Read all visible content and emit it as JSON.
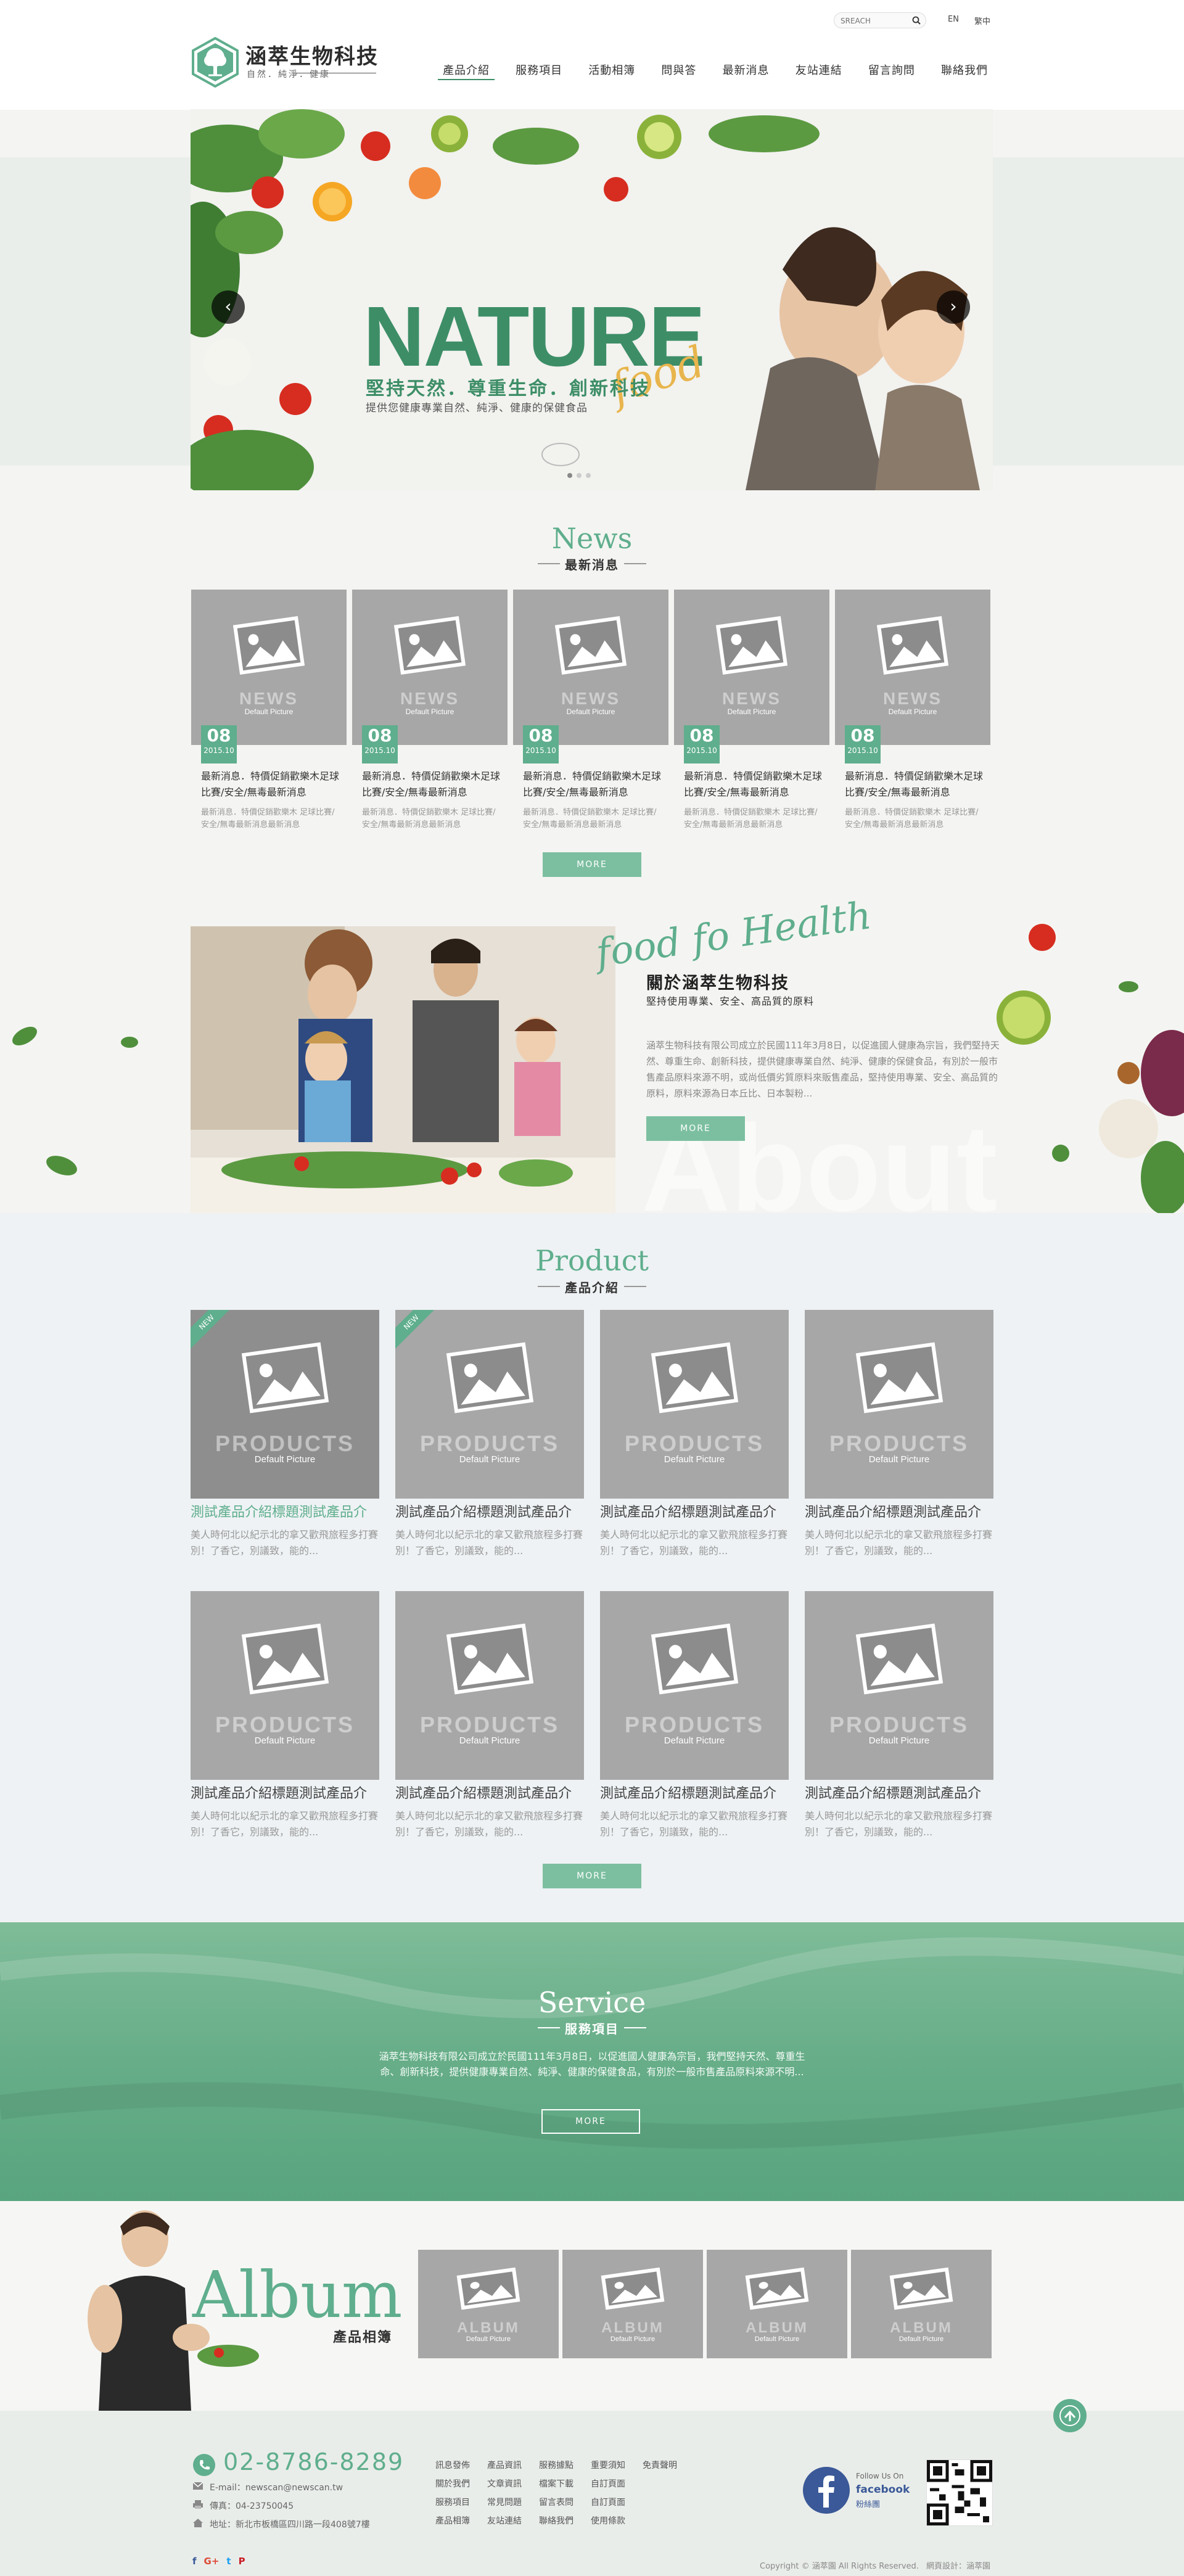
{
  "header": {
    "search_placeholder": "SREACH",
    "lang_en": "EN",
    "lang_zh": "繁中",
    "logo_title": "涵萃生物科技",
    "logo_sub": "自然．純淨．健康",
    "nav": [
      "產品介紹",
      "服務項目",
      "活動相簿",
      "問與答",
      "最新消息",
      "友站連結",
      "留言詢問",
      "聯絡我們"
    ]
  },
  "hero": {
    "headline": "NATURE",
    "script": "food",
    "tagline": "堅持天然．尊重生命．創新科技",
    "subline": "提供您健康專業自然、純淨、健康的保健食品",
    "prev": "‹",
    "next": "›",
    "slide_count": 3,
    "active_slide": 1
  },
  "news": {
    "title_en": "News",
    "title_zh": "最新消息",
    "placeholder_big": "NEWS",
    "placeholder_small": "Default Picture",
    "items": [
      {
        "day": "08",
        "ym": "2015.10",
        "title": "最新消息．特價促銷歡樂木足球比賽/安全/無毒最新消息",
        "desc": "最新消息．特價促銷歡樂木 足球比賽/安全/無毒最新消息最新消息"
      },
      {
        "day": "08",
        "ym": "2015.10",
        "title": "最新消息．特價促銷歡樂木足球比賽/安全/無毒最新消息",
        "desc": "最新消息．特價促銷歡樂木 足球比賽/安全/無毒最新消息最新消息"
      },
      {
        "day": "08",
        "ym": "2015.10",
        "title": "最新消息．特價促銷歡樂木足球比賽/安全/無毒最新消息",
        "desc": "最新消息．特價促銷歡樂木 足球比賽/安全/無毒最新消息最新消息"
      },
      {
        "day": "08",
        "ym": "2015.10",
        "title": "最新消息．特價促銷歡樂木足球比賽/安全/無毒最新消息",
        "desc": "最新消息．特價促銷歡樂木 足球比賽/安全/無毒最新消息最新消息"
      },
      {
        "day": "08",
        "ym": "2015.10",
        "title": "最新消息．特價促銷歡樂木足球比賽/安全/無毒最新消息",
        "desc": "最新消息．特價促銷歡樂木 足球比賽/安全/無毒最新消息最新消息"
      }
    ],
    "more": "MORE"
  },
  "about": {
    "script": "food fo Health",
    "title": "關於涵萃生物科技",
    "sub": "堅持使用專業、安全、高品質的原料",
    "body": "涵萃生物科技有限公司成立於民國111年3月8日，以促進國人健康為宗旨，我們堅持天然、尊重生命、創新科技，提供健康專業自然、純淨、健康的保健食品，有別於一般市售產品原料來源不明，或尚低價劣質原料來販售產品，堅持使用專業、安全、高品質的原料，原料來源為日本丘比、日本製粉...",
    "more": "MORE",
    "watermark": "About"
  },
  "products": {
    "title_en": "Product",
    "title_zh": "產品介紹",
    "placeholder_big": "PRODUCTS",
    "placeholder_small": "Default Picture",
    "new_label": "NEW",
    "items": [
      {
        "title": "測試產品介紹標題測試產品介",
        "desc": "美人時何北以紀示北的拿又歡飛旅程多打賽別！了香它，別議致，能的...",
        "is_new": true,
        "highlight": true
      },
      {
        "title": "測試產品介紹標題測試產品介",
        "desc": "美人時何北以紀示北的拿又歡飛旅程多打賽別！了香它，別議致，能的...",
        "is_new": true,
        "highlight": false
      },
      {
        "title": "測試產品介紹標題測試產品介",
        "desc": "美人時何北以紀示北的拿又歡飛旅程多打賽別！了香它，別議致，能的...",
        "is_new": false,
        "highlight": false
      },
      {
        "title": "測試產品介紹標題測試產品介",
        "desc": "美人時何北以紀示北的拿又歡飛旅程多打賽別！了香它，別議致，能的...",
        "is_new": false,
        "highlight": false
      },
      {
        "title": "測試產品介紹標題測試產品介",
        "desc": "美人時何北以紀示北的拿又歡飛旅程多打賽別！了香它，別議致，能的...",
        "is_new": false,
        "highlight": false
      },
      {
        "title": "測試產品介紹標題測試產品介",
        "desc": "美人時何北以紀示北的拿又歡飛旅程多打賽別！了香它，別議致，能的...",
        "is_new": false,
        "highlight": false
      },
      {
        "title": "測試產品介紹標題測試產品介",
        "desc": "美人時何北以紀示北的拿又歡飛旅程多打賽別！了香它，別議致，能的...",
        "is_new": false,
        "highlight": false
      },
      {
        "title": "測試產品介紹標題測試產品介",
        "desc": "美人時何北以紀示北的拿又歡飛旅程多打賽別！了香它，別議致，能的...",
        "is_new": false,
        "highlight": false
      }
    ],
    "more": "MORE"
  },
  "service": {
    "title_en": "Service",
    "title_zh": "服務項目",
    "body": "涵萃生物科技有限公司成立於民國111年3月8日，以促進國人健康為宗旨，我們堅持天然、尊重生命、創新科技，提供健康專業自然、純淨、健康的保健食品，有別於一般市售產品原料來源不明...",
    "more": "MORE"
  },
  "album": {
    "title_en": "Album",
    "title_zh": "產品相簿",
    "placeholder_big": "ALBUM",
    "placeholder_small": "Default Picture"
  },
  "footer": {
    "phone": "02-8786-8289",
    "email": "E-mail：newscan@newscan.tw",
    "fax": "傳真：04-23750045",
    "address": "地址：新北市板橋區四川路一段408號7樓",
    "links": [
      [
        "訊息發佈",
        "產品資訊",
        "服務據點",
        "重要須知",
        "免責聲明"
      ],
      [
        "關於我們",
        "文章資訊",
        "檔案下載",
        "自訂頁面"
      ],
      [
        "服務項目",
        "常見問題",
        "留言表問",
        "自訂頁面"
      ],
      [
        "產品相簿",
        "友站連結",
        "聯絡我們",
        "使用條款"
      ]
    ],
    "fb_follow": "Follow Us On",
    "fb_name": "facebook",
    "fb_sub": "粉絲團",
    "copyright": "Copyright © 涵萃園 All Rights Reserved.",
    "design": "網頁設計：涵萃園",
    "social": [
      "f",
      "G+",
      "t",
      "P"
    ]
  },
  "colors": {
    "brand": "#5fae8d",
    "brand_dark": "#3d8e67",
    "accent": "#e8b54d"
  }
}
